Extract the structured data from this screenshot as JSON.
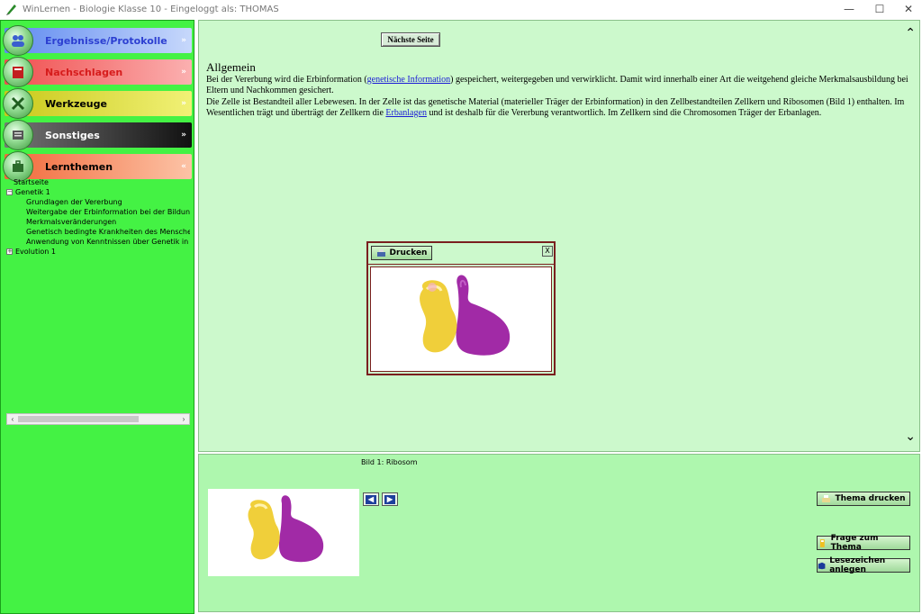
{
  "window": {
    "title": "WinLernen - Biologie Klasse 10 - Eingeloggt als: THOMAS",
    "minimize": "—",
    "maximize": "☐",
    "close": "✕"
  },
  "sidebar": {
    "nav": [
      {
        "label": "Ergebnisse/Protokolle",
        "color": "#2c3fd1",
        "bg": "#9fb7f5",
        "icon": "people-icon"
      },
      {
        "label": "Nachschlagen",
        "color": "#d61c1c",
        "bg": "#f07a7a",
        "icon": "book-icon"
      },
      {
        "label": "Werkzeuge",
        "color": "#000000",
        "bg": "#e0e02e",
        "icon": "tools-icon"
      },
      {
        "label": "Sonstiges",
        "color": "#ffffff",
        "bg": "#2a2a2a",
        "icon": "sheet-icon"
      },
      {
        "label": "Lernthemen",
        "color": "#000000",
        "bg": "#f58a5c",
        "icon": "briefcase-icon"
      }
    ],
    "tree": {
      "startseite": "Startseite",
      "genetik": "Genetik 1",
      "children": [
        "Grundlagen der Vererbung",
        "Weitergabe der Erbinformation bei der Bildung von Kä",
        "Merkmalsveränderungen",
        "Genetisch bedingte Krankheiten des Menschen",
        "Anwendung von Kenntnissen über Genetik in der Prax"
      ],
      "evolution": "Evolution 1"
    }
  },
  "content": {
    "next_page": "Nächste Seite",
    "heading": "Allgemein",
    "p1_a": "Bei der Vererbung wird die Erbinformation (",
    "p1_link": "genetische Information",
    "p1_b": ") gespeichert, weitergegeben und verwirklicht. Damit wird innerhalb einer Art die weitgehend gleiche Merkmalsausbildung bei Eltern und Nachkommen gesichert.",
    "p2_a": "Die Zelle ist Bestandteil aller Lebewesen. In der Zelle ist das genetische Material (materieller Träger der Erbinformation) in den Zellbestandteilen Zellkern und Ribosomen (Bild 1) enthalten. Im Wesentlichen trägt und überträgt der Zellkern die ",
    "p2_link": "Erbanlagen",
    "p2_b": " und ist deshalb für die Vererbung verantwortlich. Im Zellkern sind die Chromosomen Träger der Erbanlagen."
  },
  "popup": {
    "print": "Drucken",
    "close": "X"
  },
  "lower": {
    "caption": "Bild 1: Ribosom",
    "thema_drucken": "Thema drucken",
    "frage": "Frage zum Thema",
    "lesezeichen": "Lesezeichen anlegen"
  }
}
